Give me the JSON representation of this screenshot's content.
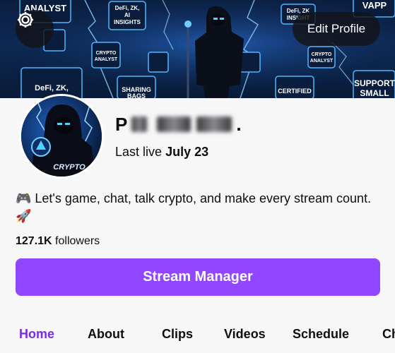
{
  "header": {
    "edit_profile_label": "Edit Profile",
    "settings_icon": "gear-icon",
    "banner_badges": [
      "ANALYST",
      "DeFi, ZK, AI INSIGHTS",
      "DeFi, ZK INSIGHT",
      "VAPP",
      "CRYPTO ANALYST",
      "CRYPTO ANALYST",
      "DeFi, ZK,",
      "SHARING BAGS",
      "CERTIFIED YAPPER",
      "SUPPORT SMALL"
    ]
  },
  "profile": {
    "name_initial": "P",
    "name_suffix": ".",
    "last_live_prefix": "Last live",
    "last_live_date": "July 23",
    "bio": "🎮 Let's game, chat, talk crypto, and make every stream count. 🚀",
    "followers_count": "127.1K",
    "followers_label": "followers",
    "avatar_text": "CRYPTO"
  },
  "actions": {
    "stream_manager_label": "Stream Manager"
  },
  "tabs": [
    {
      "label": "Home",
      "active": true
    },
    {
      "label": "About",
      "active": false
    },
    {
      "label": "Clips",
      "active": false
    },
    {
      "label": "Videos",
      "active": false
    },
    {
      "label": "Schedule",
      "active": false
    },
    {
      "label": "Ch",
      "active": false
    }
  ],
  "colors": {
    "accent": "#9146ff",
    "tab_active": "#772ce8",
    "text": "#0e0e10",
    "banner_bg": "#0d2a55"
  }
}
